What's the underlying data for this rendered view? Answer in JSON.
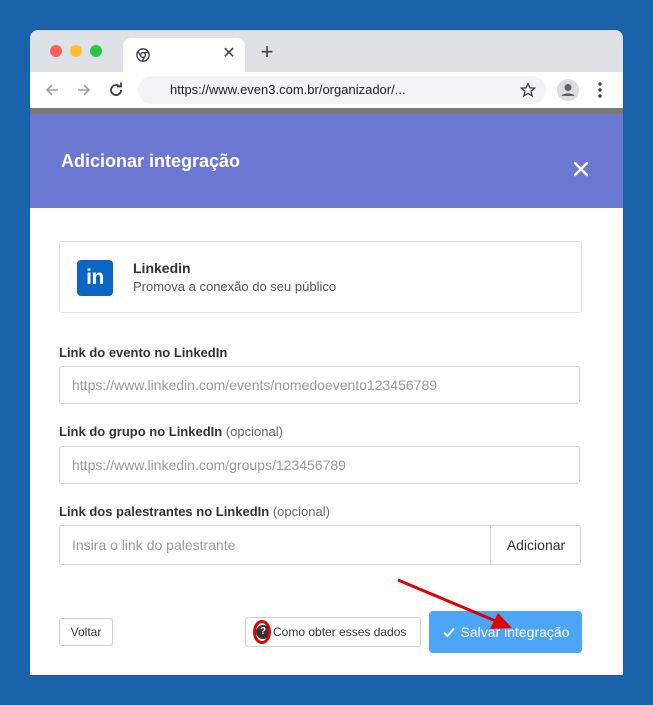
{
  "browser": {
    "url": "https://www.even3.com.br/organizador/...",
    "new_tab_label": "+",
    "tab_close_label": "✕"
  },
  "modal": {
    "title": "Adicionar integração",
    "close_label": "✕"
  },
  "integration_card": {
    "logo_text": "in",
    "name": "Linkedin",
    "description": "Promova a conexão do seu público"
  },
  "fields": {
    "event_link": {
      "label": "Link do evento no LinkedIn",
      "placeholder": "https://www.linkedin.com/events/nomedoevento123456789"
    },
    "group_link": {
      "label": "Link do grupo no LinkedIn",
      "optional": "(opcional)",
      "placeholder": "https://www.linkedin.com/groups/123456789"
    },
    "speakers_link": {
      "label": "Link dos palestrantes no LinkedIn",
      "optional": "(opcional)",
      "placeholder": "Insira o link do palestrante",
      "add_label": "Adicionar"
    }
  },
  "footer": {
    "back_label": "Voltar",
    "help_label": "Como obter esses dados",
    "save_label": "Salvar integração"
  },
  "colors": {
    "page_background": "#1a63ab",
    "modal_header": "#6b78d1",
    "save_button": "#4da6f5",
    "linkedin_blue": "#0a66c2",
    "annotation_red": "#e00000"
  },
  "icons": [
    "chrome-icon",
    "back-arrow-icon",
    "forward-arrow-icon",
    "reload-icon",
    "star-icon",
    "profile-icon",
    "menu-icon",
    "close-icon",
    "linkedin-icon",
    "help-icon",
    "check-icon",
    "annotation-arrow-icon"
  ]
}
